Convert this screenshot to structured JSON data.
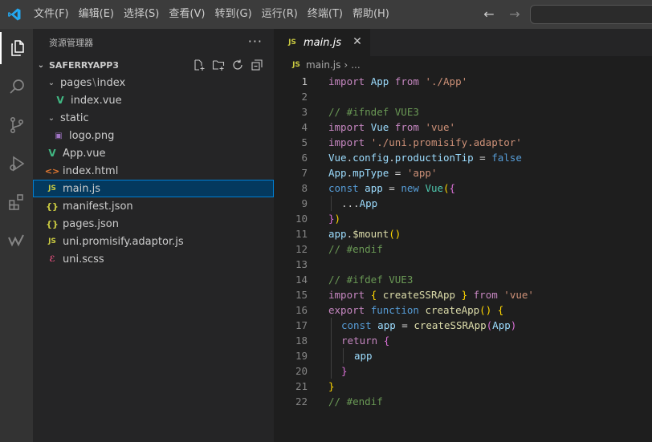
{
  "menu": [
    "文件(F)",
    "编辑(E)",
    "选择(S)",
    "查看(V)",
    "转到(G)",
    "运行(R)",
    "终端(T)",
    "帮助(H)"
  ],
  "sidebar": {
    "title": "资源管理器",
    "project": "SAFERRYAPP3",
    "files": [
      {
        "name": "pages",
        "name2": "index",
        "chev": "⌄"
      },
      {
        "name": "index.vue",
        "icon": "V"
      },
      {
        "name": "static",
        "chev": "⌄"
      },
      {
        "name": "logo.png",
        "icon": "▣"
      },
      {
        "name": "App.vue",
        "icon": "V"
      },
      {
        "name": "index.html",
        "icon": "<>"
      },
      {
        "name": "main.js",
        "icon": "JS"
      },
      {
        "name": "manifest.json",
        "icon": "{}"
      },
      {
        "name": "pages.json",
        "icon": "{}"
      },
      {
        "name": "uni.promisify.adaptor.js",
        "icon": "JS"
      },
      {
        "name": "uni.scss",
        "icon": "ℰ"
      }
    ]
  },
  "editor": {
    "tab_label": "main.js",
    "tab_icon": "JS",
    "breadcrumb": [
      "main.js",
      "..."
    ],
    "line_numbers": [
      "1",
      "2",
      "3",
      "4",
      "5",
      "6",
      "7",
      "8",
      "9",
      "10",
      "11",
      "12",
      "13",
      "14",
      "15",
      "16",
      "17",
      "18",
      "19",
      "20",
      "21",
      "22"
    ],
    "tokens": {
      "l1": [
        "import",
        "App",
        "from",
        "'./App'"
      ],
      "l3": "// #ifndef VUE3",
      "l4": [
        "import",
        "Vue",
        "from",
        "'vue'"
      ],
      "l5": [
        "import",
        "'./uni.promisify.adaptor'"
      ],
      "l6": [
        "Vue",
        ".",
        "config",
        ".",
        "productionTip",
        " = ",
        "false"
      ],
      "l7": [
        "App",
        ".",
        "mpType",
        " = ",
        "'app'"
      ],
      "l8": [
        "const",
        "app",
        " = ",
        "new",
        "Vue",
        "(",
        "{"
      ],
      "l9": [
        "...",
        "App"
      ],
      "l10": [
        "}",
        ")"
      ],
      "l11": [
        "app",
        ".",
        "$mount",
        "()"
      ],
      "l12": "// #endif",
      "l14": "// #ifdef VUE3",
      "l15": [
        "import",
        "{",
        "createSSRApp",
        "}",
        "from",
        "'vue'"
      ],
      "l16": [
        "export",
        "function",
        "createApp",
        "()",
        "{"
      ],
      "l17": [
        "const",
        "app",
        " = ",
        "createSSRApp",
        "(",
        "App",
        ")"
      ],
      "l18": [
        "return",
        "{"
      ],
      "l19": [
        "app"
      ],
      "l20": [
        "}"
      ],
      "l21": [
        "}"
      ],
      "l22": "// #endif"
    }
  }
}
